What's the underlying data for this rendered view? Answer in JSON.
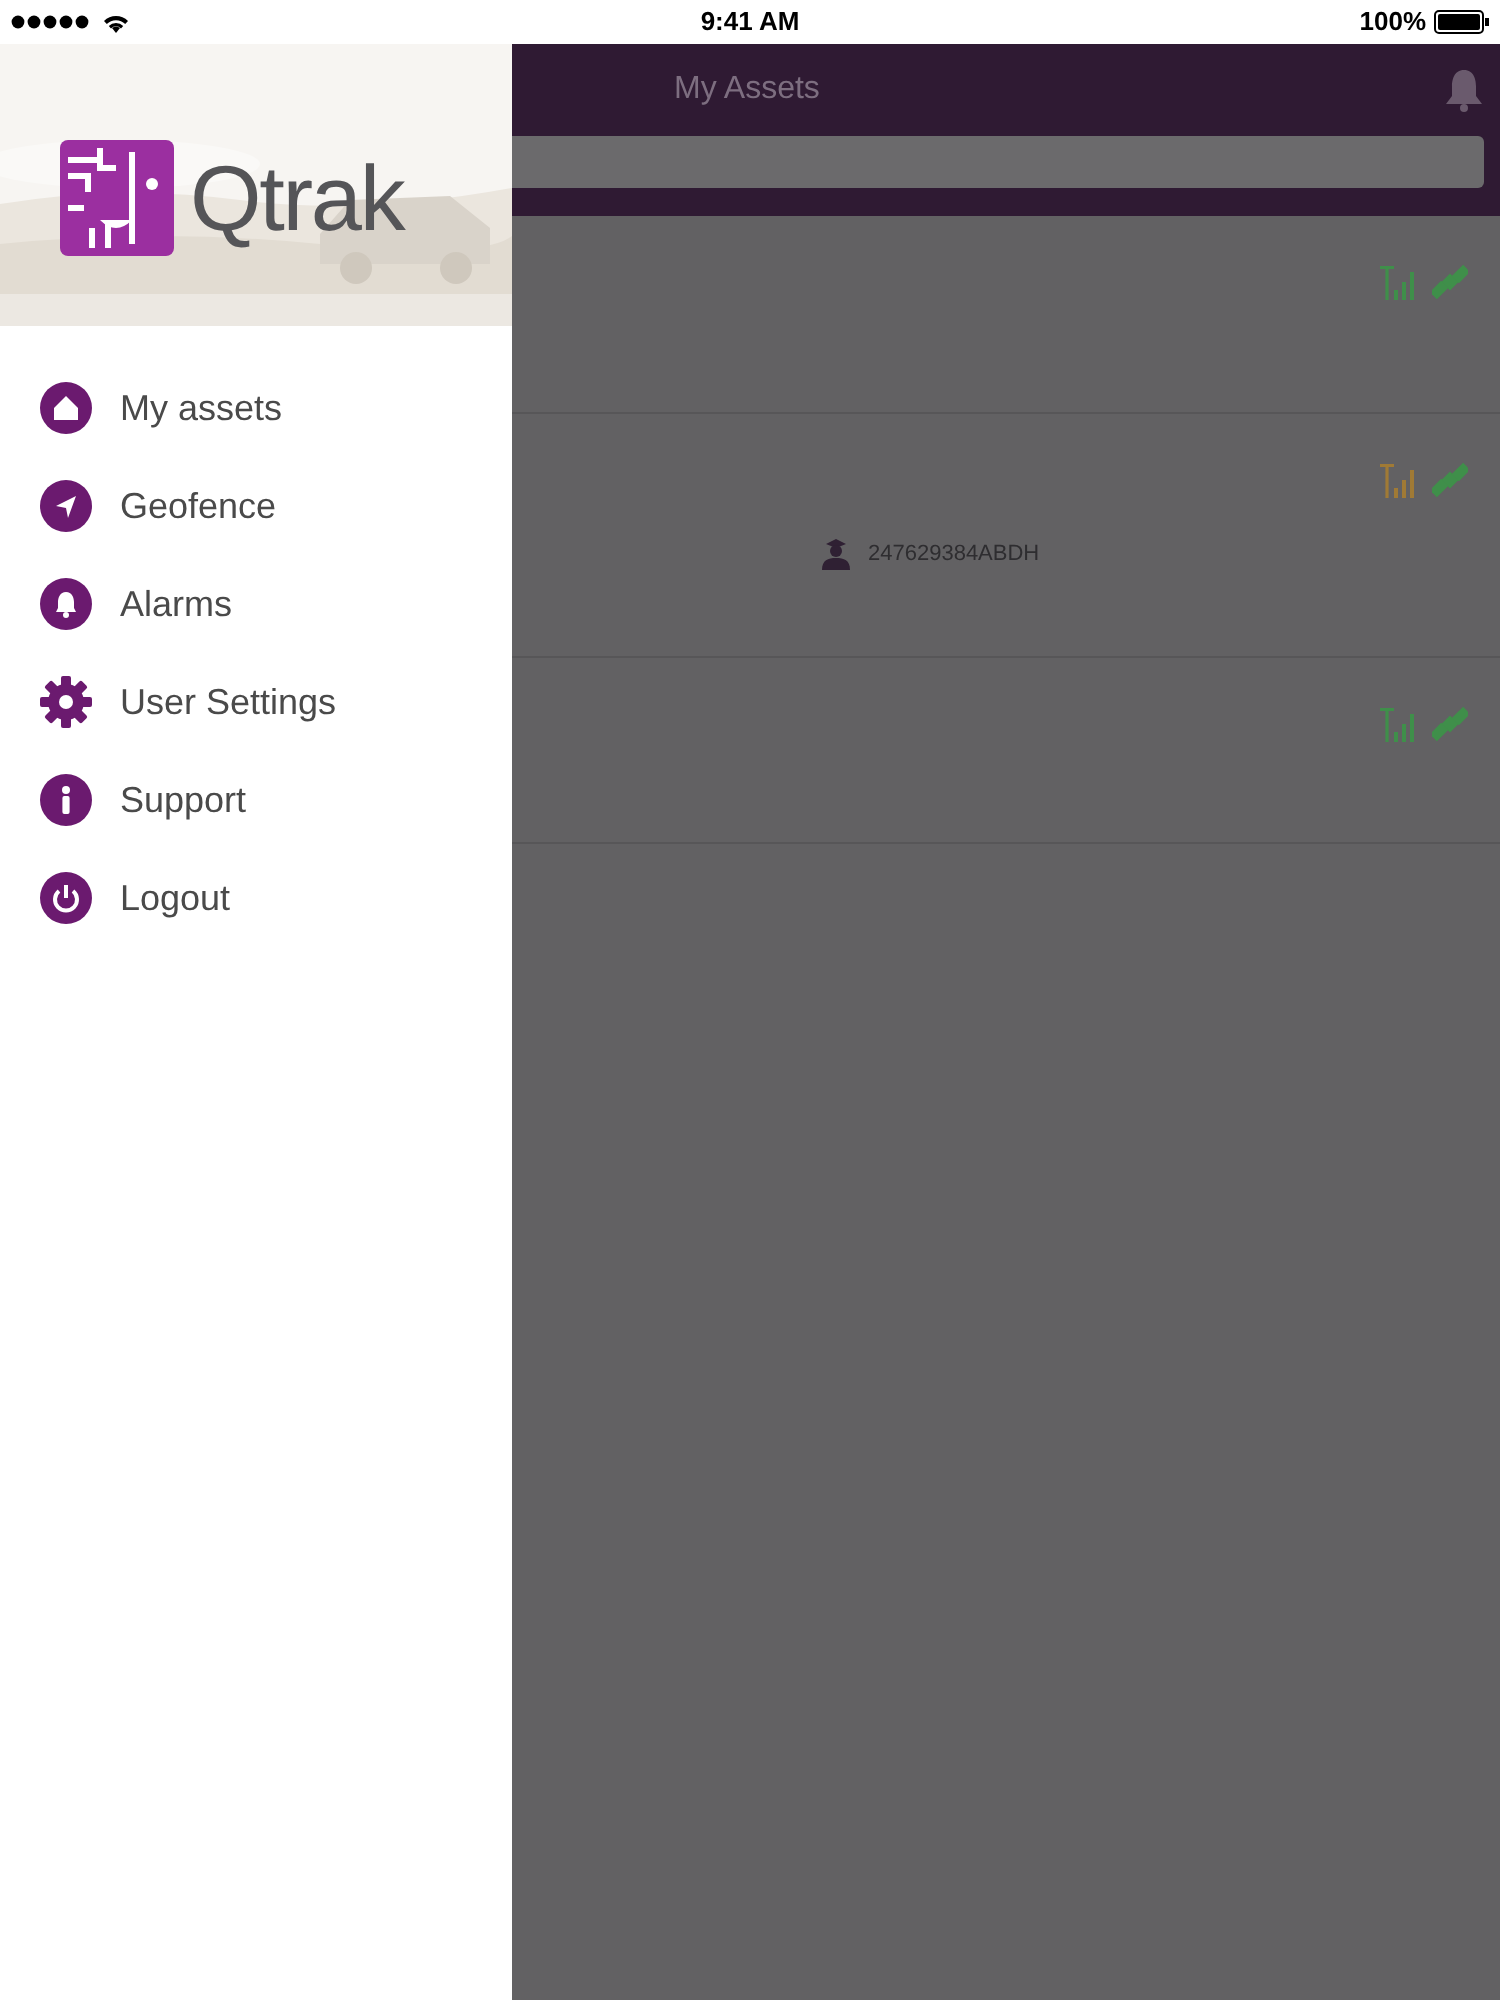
{
  "status_bar": {
    "time": "9:41 AM",
    "battery": "100%"
  },
  "drawer": {
    "logo": "Qtrak",
    "items": [
      {
        "label": "My assets",
        "kind": "home"
      },
      {
        "label": "Geofence",
        "kind": "navigate"
      },
      {
        "label": "Alarms",
        "kind": "bell"
      },
      {
        "label": "User Settings",
        "kind": "gear"
      },
      {
        "label": "Support",
        "kind": "info"
      },
      {
        "label": "Logout",
        "kind": "power"
      }
    ]
  },
  "app": {
    "title": "My Assets",
    "assets": [
      {
        "color": "#3f8f4a"
      },
      {
        "color": "#a07a35",
        "driver": "247629384ABDH"
      },
      {
        "color": "#3f8f4a"
      }
    ]
  }
}
